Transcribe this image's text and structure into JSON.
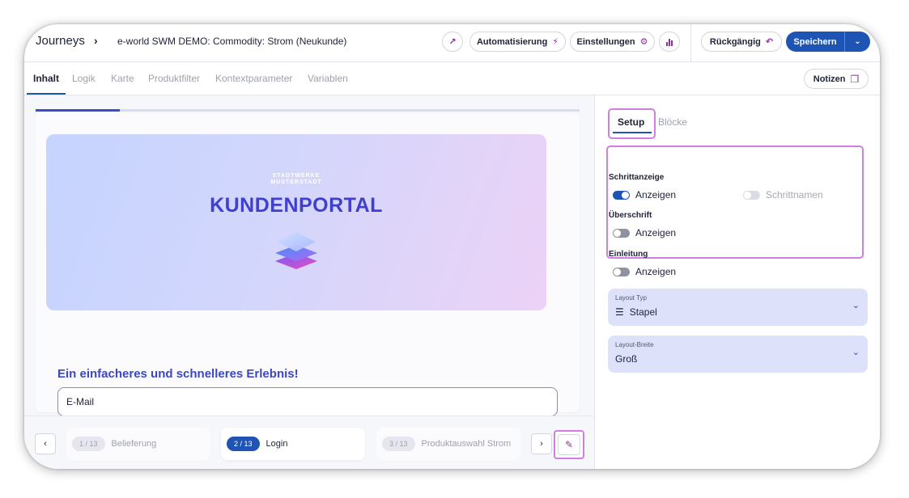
{
  "header": {
    "breadcrumb_root": "Journeys",
    "breadcrumb_sep": "›",
    "journey_title": "e-world SWM DEMO: Commodity: Strom (Neukunde)",
    "external_link_icon": "↗",
    "automation_label": "Automatisierung",
    "automation_icon": "⚡",
    "settings_label": "Einstellungen",
    "settings_icon": "⚙",
    "analytics_icon": "▮",
    "undo_label": "Rückgängig",
    "undo_icon": "↶",
    "save_label": "Speichern",
    "save_caret": "⌄"
  },
  "tabs": {
    "items": [
      "Inhalt",
      "Logik",
      "Karte",
      "Produktfilter",
      "Kontextparameter",
      "Variablen"
    ],
    "active": "Inhalt",
    "notes_label": "Notizen",
    "notes_icon": "❐"
  },
  "preview": {
    "progress_fraction": 0.155,
    "hero_brand_line1": "STADTWERKE",
    "hero_brand_line2": "MUSTERSTADT",
    "hero_title": "KUNDENPORTAL",
    "headline": "Ein einfacheres und schnelleres Erlebnis!",
    "email_label": "E-Mail"
  },
  "stepper": {
    "prev_icon": "‹",
    "next_icon": "›",
    "edit_icon": "✎",
    "steps": [
      {
        "badge": "1 / 13",
        "name": "Belieferung"
      },
      {
        "badge": "2 / 13",
        "name": "Login"
      },
      {
        "badge": "3 / 13",
        "name": "Produktauswahl Strom"
      }
    ],
    "active_index": 1
  },
  "panel": {
    "tabs": [
      "Setup",
      "Blöcke"
    ],
    "active_tab": "Setup",
    "sections": {
      "step_display": {
        "label": "Schrittanzeige",
        "toggle": "Anzeigen",
        "on": true,
        "secondary_toggle": "Schrittnamen",
        "secondary_on": false
      },
      "heading": {
        "label": "Überschrift",
        "toggle": "Anzeigen",
        "on": false
      },
      "intro": {
        "label": "Einleitung",
        "toggle": "Anzeigen",
        "on": false
      }
    },
    "layout_type": {
      "label": "Layout Typ",
      "value": "Stapel",
      "icon": "☰"
    },
    "layout_width": {
      "label": "Layout-Breite",
      "value": "Groß"
    },
    "chevron": "⌄"
  },
  "colors": {
    "primary": "#1e55b4",
    "accent_purple": "#8d2f9c",
    "highlight": "#cf7fe0",
    "hero_title": "#3f3fd0"
  }
}
